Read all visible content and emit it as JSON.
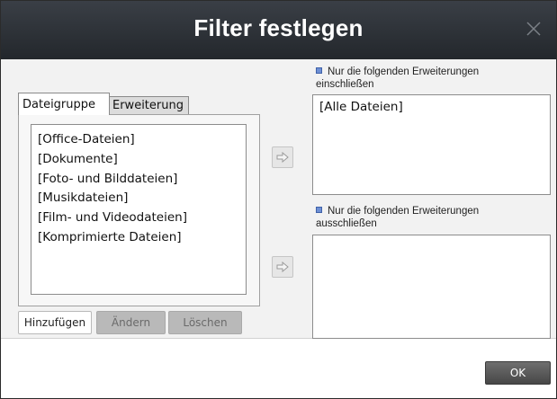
{
  "dialog": {
    "title": "Filter festlegen",
    "close_icon": "close-icon"
  },
  "tabs": [
    {
      "label": "Dateigruppe",
      "active": true
    },
    {
      "label": "Erweiterung",
      "active": false
    }
  ],
  "file_groups": [
    "[Office-Dateien]",
    "[Dokumente]",
    "[Foto- und Bilddateien]",
    "[Musikdateien]",
    "[Film- und Videodateien]",
    "[Komprimierte Dateien]"
  ],
  "buttons": {
    "add": "Hinzufügen",
    "edit": "Ändern",
    "delete": "Löschen",
    "ok": "OK"
  },
  "include": {
    "label": "Nur die folgenden Erweiterungen einschließen",
    "items": [
      "[Alle Dateien]"
    ]
  },
  "exclude": {
    "label": "Nur die folgenden Erweiterungen ausschließen",
    "items": []
  },
  "icons": {
    "arrow": "arrow-right-icon",
    "bullet": "bullet-icon"
  },
  "colors": {
    "titlebar": "#2f3439",
    "bullet": "#6d8fd4",
    "ok_button": "#5a5a5a"
  }
}
